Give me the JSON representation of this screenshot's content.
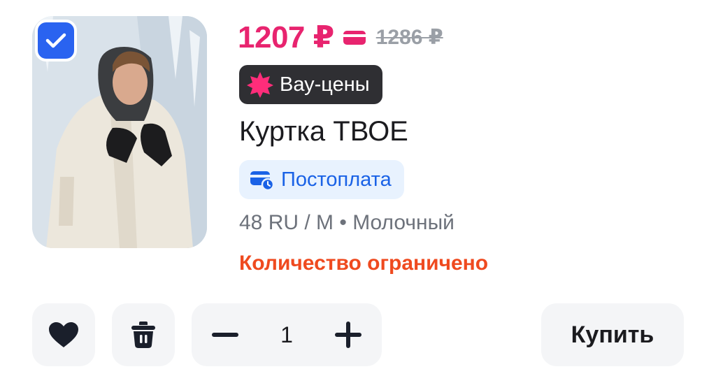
{
  "product": {
    "price": "1207 ₽",
    "old_price": "1286 ₽",
    "promo_badge": "Вау-цены",
    "title": "Куртка ТВОЕ",
    "payment_badge": "Постоплата",
    "variant": "48 RU / M • Молочный",
    "stock_note": "Количество ограничено",
    "selected": true
  },
  "actions": {
    "quantity": "1",
    "buy_label": "Купить"
  },
  "colors": {
    "price": "#e8246f",
    "promo_bg": "#2f2f33",
    "promo_star": "#ff2d7a",
    "payment_text": "#1a62e6",
    "payment_bg": "#e8f2fe",
    "stock_note": "#ef4a1f",
    "checkbox": "#2a63f0",
    "button_bg": "#f4f5f7"
  },
  "icons": {
    "checkbox": "check-icon",
    "price_card": "card-icon",
    "promo": "star-burst-icon",
    "payment": "wallet-clock-icon",
    "favorite": "heart-icon",
    "delete": "trash-icon",
    "decrease": "minus-icon",
    "increase": "plus-icon"
  }
}
